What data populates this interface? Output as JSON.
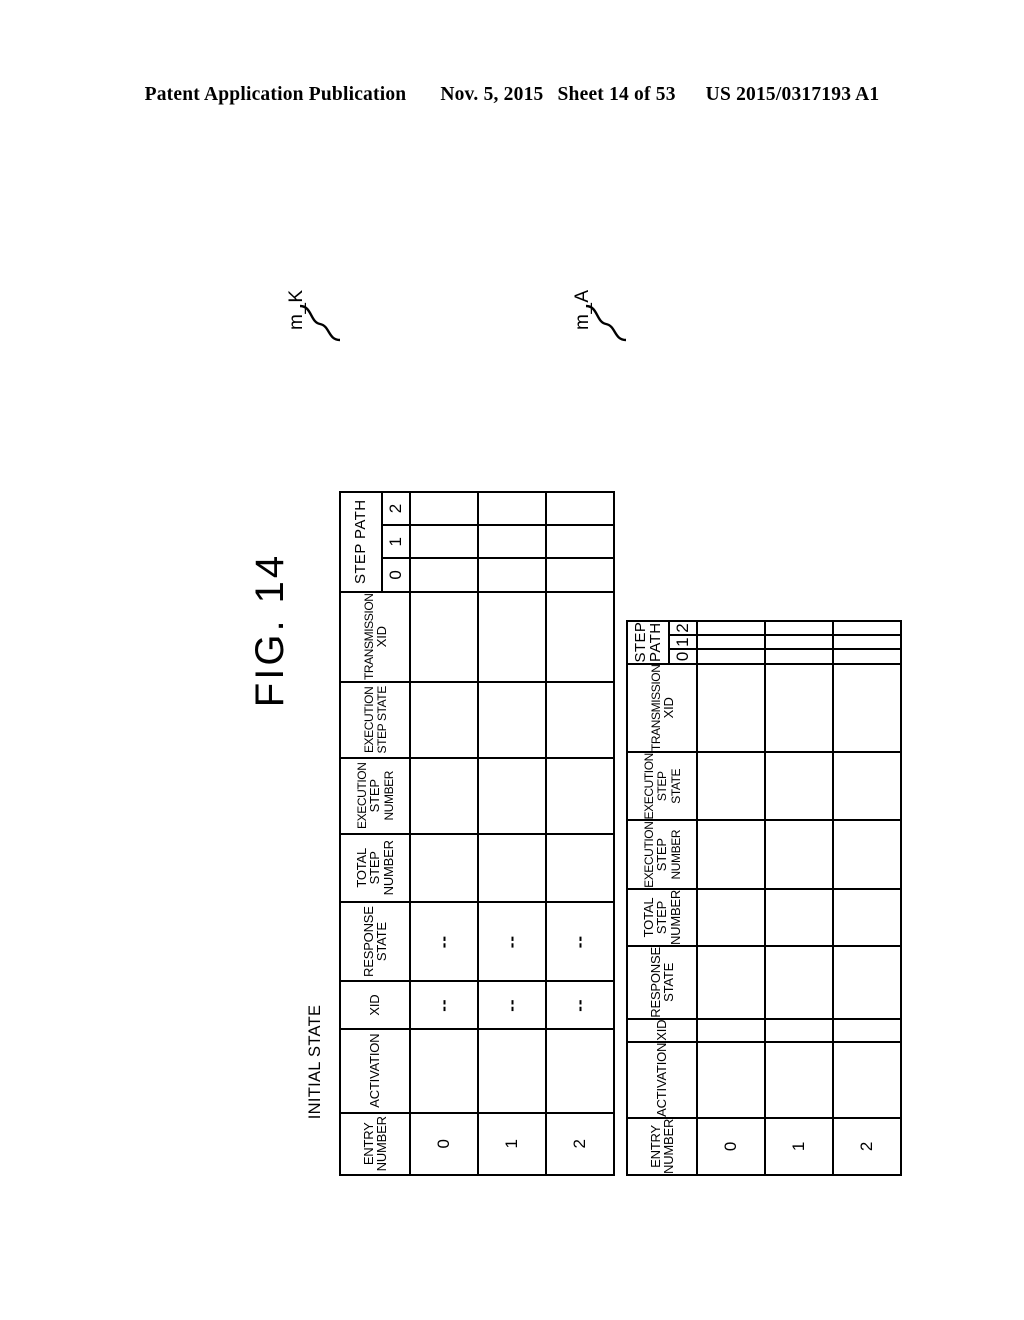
{
  "header": {
    "publication": "Patent Application Publication",
    "date": "Nov. 5, 2015",
    "sheet": "Sheet 14 of 53",
    "patent_number": "US 2015/0317193 A1"
  },
  "figure": {
    "title": "FIG. 14",
    "state_label": "INITIAL STATE"
  },
  "callouts": {
    "table_k": "m_K",
    "table_a": "m_A"
  },
  "columns": {
    "entry_number": "ENTRY\nNUMBER",
    "entry_number_l1": "ENTRY",
    "entry_number_l2": "NUMBER",
    "activation": "ACTIVATION",
    "xid": "XID",
    "response_state_l1": "RESPONSE",
    "response_state_l2": "STATE",
    "total_step_l1": "TOTAL",
    "total_step_l2": "STEP",
    "total_step_l3": "NUMBER",
    "execution_step_number_l1": "EXECUTION",
    "execution_step_number_l2": "STEP",
    "execution_step_number_l3": "NUMBER",
    "execution_step_state_l1": "EXECUTION",
    "execution_step_state_l2": "STEP STATE",
    "transmission_xid_l1": "TRANSMISSION",
    "transmission_xid_l2": "XID",
    "step_path": "STEP PATH",
    "step_path_sub": [
      "0",
      "1",
      "2"
    ]
  },
  "tables": [
    {
      "id": "m_K",
      "rows": [
        {
          "entry_number": "0",
          "activation": "",
          "xid": "--",
          "response_state": "--",
          "total_step_number": "",
          "execution_step_number": "",
          "execution_step_state": "",
          "transmission_xid": "",
          "step_path": [
            "",
            "",
            ""
          ]
        },
        {
          "entry_number": "1",
          "activation": "",
          "xid": "--",
          "response_state": "--",
          "total_step_number": "",
          "execution_step_number": "",
          "execution_step_state": "",
          "transmission_xid": "",
          "step_path": [
            "",
            "",
            ""
          ]
        },
        {
          "entry_number": "2",
          "activation": "",
          "xid": "--",
          "response_state": "--",
          "total_step_number": "",
          "execution_step_number": "",
          "execution_step_state": "",
          "transmission_xid": "",
          "step_path": [
            "",
            "",
            ""
          ]
        }
      ]
    },
    {
      "id": "m_A",
      "rows": [
        {
          "entry_number": "0",
          "activation": "",
          "xid": "",
          "response_state": "",
          "total_step_number": "",
          "execution_step_number": "",
          "execution_step_state": "",
          "transmission_xid": "",
          "step_path": [
            "",
            "",
            ""
          ]
        },
        {
          "entry_number": "1",
          "activation": "",
          "xid": "",
          "response_state": "",
          "total_step_number": "",
          "execution_step_number": "",
          "execution_step_state": "",
          "transmission_xid": "",
          "step_path": [
            "",
            "",
            ""
          ]
        },
        {
          "entry_number": "2",
          "activation": "",
          "xid": "",
          "response_state": "",
          "total_step_number": "",
          "execution_step_number": "",
          "execution_step_state": "",
          "transmission_xid": "",
          "step_path": [
            "",
            "",
            ""
          ]
        }
      ]
    }
  ]
}
